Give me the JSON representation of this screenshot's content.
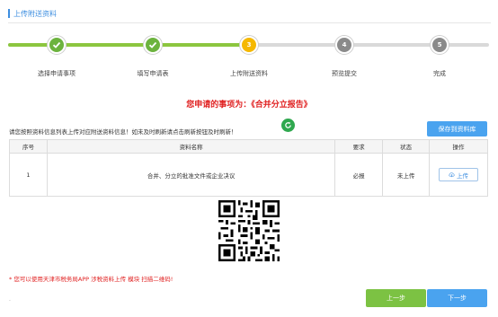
{
  "page_title": "上传附送资料",
  "steps": [
    {
      "label": "选择申请事项",
      "status": "done",
      "num": "1"
    },
    {
      "label": "填写申请表",
      "status": "done",
      "num": "2"
    },
    {
      "label": "上传附送资料",
      "status": "active",
      "num": "3"
    },
    {
      "label": "预览提交",
      "status": "todo",
      "num": "4"
    },
    {
      "label": "完成",
      "status": "todo",
      "num": "5"
    }
  ],
  "headline": "您申请的事项为：《合并分立报告》",
  "notice": "请您按照资料信息列表上传对应附送资料信息！如未及时刷新请点击刷新按钮及时刷新！",
  "save_button": "保存到资料库",
  "table": {
    "headers": [
      "序号",
      "资料名称",
      "要求",
      "状态",
      "操作"
    ],
    "rows": [
      {
        "index": "1",
        "name": "合并、分立的批准文件或企业决议",
        "requirement": "必报",
        "status": "未上传",
        "action": "上传"
      }
    ]
  },
  "hint": "* 您可以使用天津市税务局APP 涉税资料上传 模块 扫描二维码!",
  "footer_dot": ".",
  "prev_button": "上一步",
  "next_button": "下一步",
  "colors": {
    "accent": "#3d8ee0",
    "done": "#6cb33e",
    "active": "#f5b800",
    "todo": "#8a8a8a",
    "warning": "#e02020",
    "primary_button": "#4aa3ef",
    "secondary_button": "#7cc243"
  },
  "icons": {
    "step_done": "checkmark-icon",
    "refresh": "refresh-icon",
    "upload": "cloud-upload-icon",
    "qr": "qr-code"
  }
}
